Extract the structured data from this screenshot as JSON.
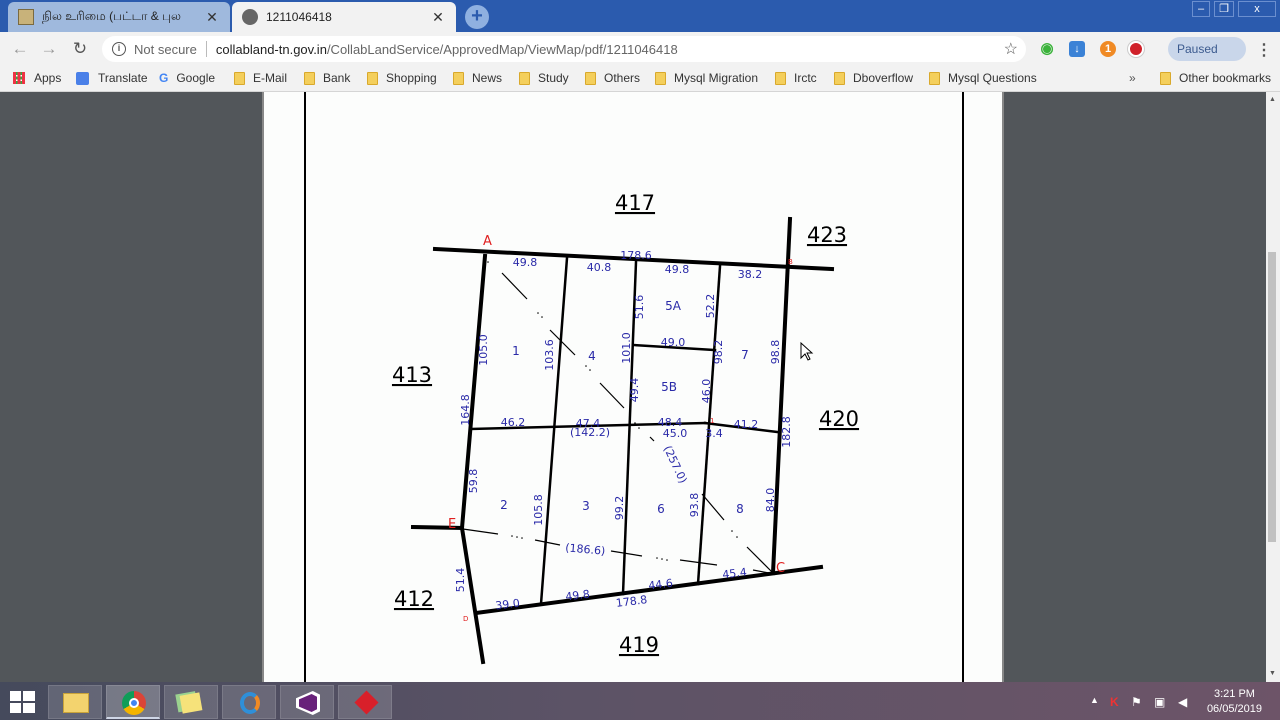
{
  "browser": {
    "tabs": [
      {
        "title": "நில உரிமை (பட்டா & புல",
        "icon": "tamilnadu-emblem-icon",
        "active": false
      },
      {
        "title": "1211046418",
        "icon": "globe-icon",
        "active": true
      }
    ],
    "new_tab_label": "+",
    "window_controls": {
      "minimize": "–",
      "restore": "❐",
      "close": "x"
    },
    "address_bar": {
      "security_label": "Not secure",
      "domain": "collabland-tn.gov.in",
      "path": "/CollabLandService/ApprovedMap/ViewMap/pdf/1211046418"
    },
    "extensions": [
      {
        "name": "wifi-extension",
        "badge": ""
      },
      {
        "name": "download-extension",
        "badge": ""
      },
      {
        "name": "notification-extension",
        "badge": "1"
      },
      {
        "name": "opera-extension",
        "badge": ""
      }
    ],
    "profile_label": "Paused",
    "bookmarks": [
      {
        "label": "Apps",
        "icon": "apps-grid-icon"
      },
      {
        "label": "Translate",
        "icon": "translate-icon"
      },
      {
        "label": "Google",
        "icon": "google-icon"
      },
      {
        "label": "E-Mail",
        "icon": "folder-icon"
      },
      {
        "label": "Bank",
        "icon": "folder-icon"
      },
      {
        "label": "Shopping",
        "icon": "folder-icon"
      },
      {
        "label": "News",
        "icon": "folder-icon"
      },
      {
        "label": "Study",
        "icon": "folder-icon"
      },
      {
        "label": "Others",
        "icon": "folder-icon"
      },
      {
        "label": "Mysql Migration",
        "icon": "folder-icon"
      },
      {
        "label": "Irctc",
        "icon": "folder-icon"
      },
      {
        "label": "Dboverflow",
        "icon": "folder-icon"
      },
      {
        "label": "Mysql Questions",
        "icon": "folder-icon"
      }
    ],
    "bookmarks_overflow": "»",
    "other_bookmarks": "Other bookmarks"
  },
  "map": {
    "neighbor_survey_numbers": {
      "north": "417",
      "northeast": "423",
      "west": "413",
      "east": "420",
      "southwest": "412",
      "south": "419"
    },
    "corner_labels": {
      "A": "A",
      "B": "B",
      "C": "C",
      "D": "D",
      "E": "E",
      "junction": "1"
    },
    "subdivisions": [
      "1",
      "4",
      "5A",
      "5B",
      "7",
      "2",
      "3",
      "6",
      "8"
    ],
    "measurements": {
      "top_total": "178.6",
      "top_segments": [
        "49.8",
        "40.8",
        "49.8",
        "38.2"
      ],
      "left_total": "164.8",
      "left_upper": "105.0",
      "left_lower": "59.8",
      "left_bottom": "51.4",
      "div_1_4": "103.6",
      "div_4_5_upper": "101.0",
      "div_5a_left": "51.6",
      "div_5b_left": "49.4",
      "div_5a_right": "52.2",
      "div_5b_right": "46.0",
      "div_5_7": "98.2",
      "right_upper": "98.8",
      "right_total": "182.8",
      "right_lower": "84.0",
      "mid_5a_5b": "49.0",
      "mid_row_segments": [
        "46.2",
        "47.4",
        "48.4",
        "41.2"
      ],
      "mid_row_total": "(142.2)",
      "mid_row_below": "45.0",
      "mid_small": "3.4",
      "diagonal_A_C": "(257.0)",
      "diagonal_E_C": "(186.6)",
      "div_2_3": "105.8",
      "div_3_6": "99.2",
      "div_6_8": "93.8",
      "bottom_segments": [
        "39.0",
        "49.8",
        "44.6",
        "45.4"
      ],
      "bottom_total": "178.8"
    }
  },
  "taskbar": {
    "apps": [
      "windows-start",
      "file-explorer",
      "chrome",
      "sticky-notes",
      "app-icon",
      "visual-studio",
      "red-diamond-app"
    ],
    "clock_time": "3:21 PM",
    "clock_date": "06/05/2019"
  }
}
